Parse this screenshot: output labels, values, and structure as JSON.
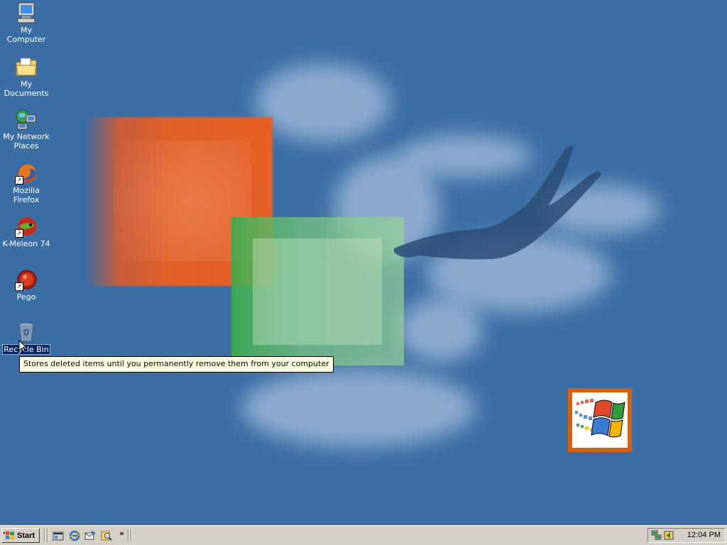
{
  "desktop": {
    "icons": [
      {
        "label": "My Computer"
      },
      {
        "label": "My Documents"
      },
      {
        "label": "My Network Places"
      },
      {
        "label": "Mozilla Firefox"
      },
      {
        "label": "K-Meleon 74"
      },
      {
        "label": "Pego"
      },
      {
        "label": "Recycle Bin"
      }
    ],
    "tooltip": "Stores deleted items until you permanently remove them from your computer"
  },
  "taskbar": {
    "start_label": "Start",
    "quick_launch_icons": [
      "show-desktop-icon",
      "internet-explorer-icon",
      "outlook-express-icon",
      "search-icon"
    ],
    "overflow_glyph": "»",
    "tray_icons": [
      "network-icon",
      "volume-icon"
    ],
    "clock": "12:04 PM"
  },
  "colors": {
    "desktop_background": "#3b6ea5",
    "taskbar": "#d4d0c8",
    "tooltip_background": "#ffffe1",
    "selection": "#0a246a"
  }
}
